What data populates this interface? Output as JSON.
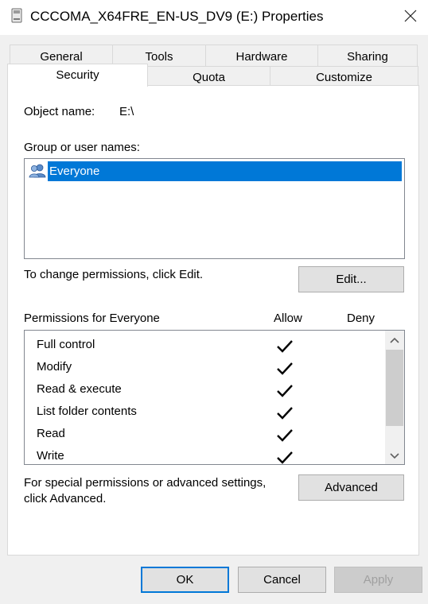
{
  "window": {
    "title": "CCCOMA_X64FRE_EN-US_DV9 (E:) Properties",
    "close_glyph": "✕"
  },
  "tabs": {
    "row1": [
      {
        "label": "General"
      },
      {
        "label": "Tools"
      },
      {
        "label": "Hardware"
      },
      {
        "label": "Sharing"
      }
    ],
    "row2": [
      {
        "label": "Security",
        "active": true
      },
      {
        "label": "Quota"
      },
      {
        "label": "Customize"
      }
    ]
  },
  "security": {
    "object_name_label": "Object name:",
    "object_name_value": "E:\\",
    "group_label": "Group or user names:",
    "groups": [
      {
        "name": "Everyone",
        "icon": "users-icon",
        "selected": true
      }
    ],
    "change_text": "To change permissions, click Edit.",
    "edit_button": "Edit...",
    "permissions_label": "Permissions for Everyone",
    "allow_header": "Allow",
    "deny_header": "Deny",
    "permissions": [
      {
        "name": "Full control",
        "allow": true,
        "deny": false
      },
      {
        "name": "Modify",
        "allow": true,
        "deny": false
      },
      {
        "name": "Read & execute",
        "allow": true,
        "deny": false
      },
      {
        "name": "List folder contents",
        "allow": true,
        "deny": false
      },
      {
        "name": "Read",
        "allow": true,
        "deny": false
      },
      {
        "name": "Write",
        "allow": true,
        "deny": false
      }
    ],
    "special_text_line1": "For special permissions or advanced settings,",
    "special_text_line2": "click Advanced.",
    "advanced_button": "Advanced"
  },
  "footer": {
    "ok": "OK",
    "cancel": "Cancel",
    "apply": "Apply"
  },
  "colors": {
    "selection": "#0078d7",
    "panel_bg": "#ffffff",
    "window_bg": "#f0f0f0"
  }
}
